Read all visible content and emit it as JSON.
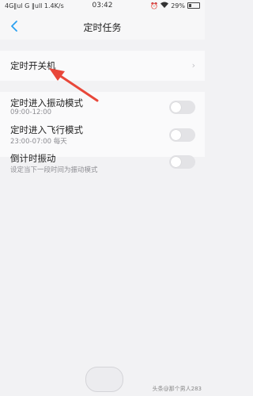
{
  "status_bar": {
    "left_text": "4G‖ul G ‖ull 1.4K/s",
    "time": "03:42",
    "battery": "29%"
  },
  "header": {
    "title": "定时任务"
  },
  "main": {
    "power_schedule": {
      "label": "定时开关机"
    },
    "vibrate_mode": {
      "label": "定时进入振动模式",
      "subtitle": "09:00-12:00",
      "enabled": false
    },
    "airplane_mode": {
      "label": "定时进入飞行模式",
      "subtitle": "23:00-07:00 每天",
      "enabled": false
    },
    "countdown_vibrate": {
      "label": "倒计时振动",
      "subtitle": "设定当下一段时间为振动模式",
      "enabled": false
    }
  },
  "watermark": "头条@那个男人283",
  "colors": {
    "accent": "#2aa0f0",
    "arrow": "#e8473a",
    "toggle_off": "#e3e3e6"
  }
}
